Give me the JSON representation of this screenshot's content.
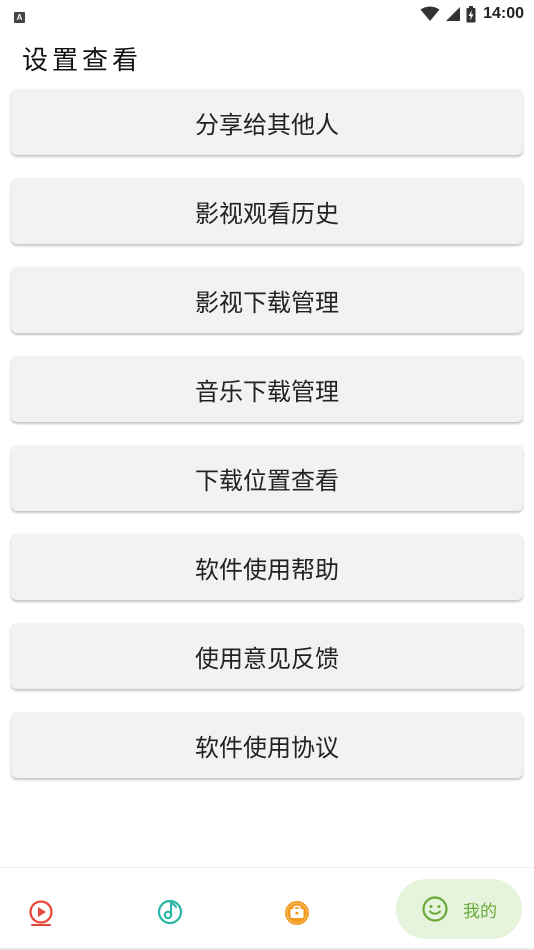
{
  "status_bar": {
    "notification_icon": "a-icon",
    "notification_letter": "A",
    "time": "14:00",
    "icons": [
      "wifi-icon",
      "signal-icon",
      "battery-icon"
    ]
  },
  "header": {
    "title": "设置查看"
  },
  "menu": {
    "items": [
      {
        "label": "分享给其他人"
      },
      {
        "label": "影视观看历史"
      },
      {
        "label": "影视下载管理"
      },
      {
        "label": "音乐下载管理"
      },
      {
        "label": "下载位置查看"
      },
      {
        "label": "软件使用帮助"
      },
      {
        "label": "使用意见反馈"
      },
      {
        "label": "软件使用协议"
      }
    ]
  },
  "bottom_nav": {
    "items": [
      {
        "icon": "play-circle-icon",
        "color": "#e8483a"
      },
      {
        "icon": "music-disc-icon",
        "color": "#26b5a5"
      },
      {
        "icon": "toolbox-icon",
        "color": "#f39a1e"
      },
      {
        "icon": "smile-icon",
        "color": "#6aaa3c",
        "label": "我的",
        "active": true
      }
    ],
    "active_bg": "#e6f4dc"
  }
}
